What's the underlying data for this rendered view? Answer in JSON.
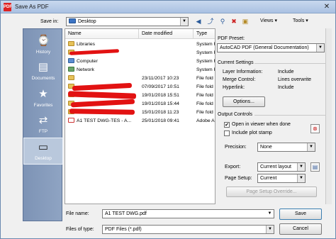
{
  "window": {
    "title": "Save As PDF",
    "app_icon": "pdf-icon"
  },
  "toolbar": {
    "save_in_label": "Save in:",
    "save_in_value": "Desktop",
    "views_label": "Views",
    "tools_label": "Tools"
  },
  "places": [
    {
      "label": "History",
      "icon": "history-icon"
    },
    {
      "label": "Documents",
      "icon": "documents-icon"
    },
    {
      "label": "Favorites",
      "icon": "favorites-icon"
    },
    {
      "label": "FTP",
      "icon": "ftp-icon"
    },
    {
      "label": "Desktop",
      "icon": "desktop-icon"
    }
  ],
  "filelist": {
    "columns": [
      "Name",
      "Date modified",
      "Type"
    ],
    "rows": [
      {
        "name": "Libraries",
        "date": "",
        "type": "System F",
        "icon": "lib"
      },
      {
        "name": "",
        "date": "",
        "type": "System F",
        "icon": "fold"
      },
      {
        "name": "Computer",
        "date": "",
        "type": "System F",
        "icon": "pc"
      },
      {
        "name": "Network",
        "date": "",
        "type": "System F",
        "icon": "net"
      },
      {
        "name": "",
        "date": "23/11/2017 10:23",
        "type": "File fold",
        "icon": "fold"
      },
      {
        "name": "",
        "date": "07/09/2017 10:51",
        "type": "File fold",
        "icon": "fold"
      },
      {
        "name": "",
        "date": "19/01/2018 15:51",
        "type": "File fold",
        "icon": "fold"
      },
      {
        "name": "",
        "date": "19/01/2018 15:44",
        "type": "File fold",
        "icon": "fold"
      },
      {
        "name": "",
        "date": "15/01/2018 11:23",
        "type": "File fold",
        "icon": "fold"
      },
      {
        "name": "A1 TEST DWG-TES - A...",
        "date": "25/01/2018 09:41",
        "type": "Adobe A",
        "icon": "pdf"
      }
    ]
  },
  "options": {
    "pdf_preset_label": "PDF Preset:",
    "pdf_preset_value": "AutoCAD PDF (General Documentation)",
    "current_settings_label": "Current Settings",
    "settings": [
      {
        "key": "Layer Information:",
        "value": "Include"
      },
      {
        "key": "Merge Control:",
        "value": "Lines overwrite"
      },
      {
        "key": "Hyperlink:",
        "value": "Include"
      }
    ],
    "options_button": "Options...",
    "output_controls_label": "Output Controls",
    "open_in_viewer_label": "Open in viewer when done",
    "open_in_viewer_checked": true,
    "include_plot_stamp_label": "Include plot stamp",
    "include_plot_stamp_checked": false,
    "precision_label": "Precision:",
    "precision_value": "None",
    "export_label": "Export:",
    "export_value": "Current layout",
    "page_setup_label": "Page Setup:",
    "page_setup_value": "Current",
    "page_setup_override_button": "Page Setup Override..."
  },
  "footer": {
    "file_name_label": "File name:",
    "file_name_value": "A1 TEST DWG.pdf",
    "file_type_label": "Files of type:",
    "file_type_value": "PDF Files (*.pdf)",
    "save_button": "Save",
    "cancel_button": "Cancel"
  }
}
